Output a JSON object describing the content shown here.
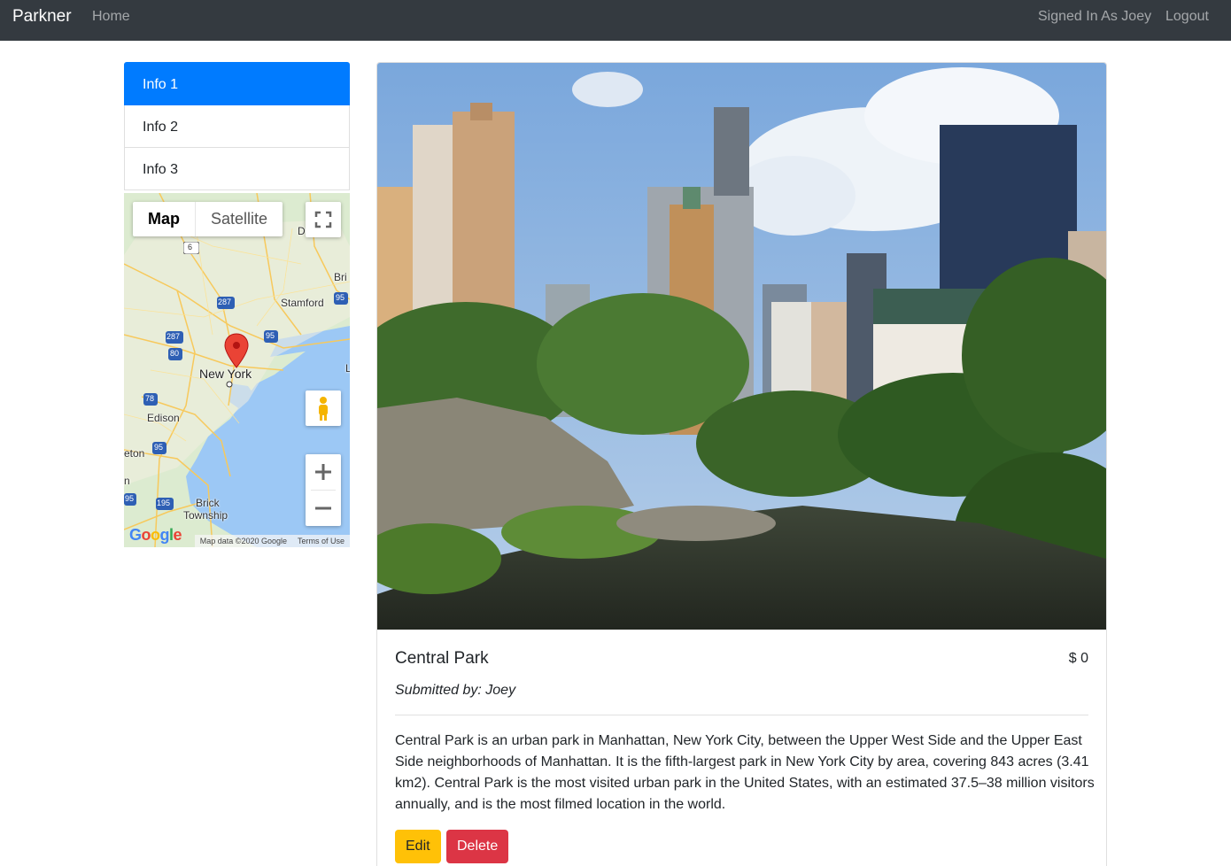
{
  "nav": {
    "brand": "Parkner",
    "home": "Home",
    "signed_in": "Signed In As Joey",
    "logout": "Logout"
  },
  "sidebar": {
    "items": [
      {
        "label": "Info 1",
        "active": true
      },
      {
        "label": "Info 2",
        "active": false
      },
      {
        "label": "Info 3",
        "active": false
      }
    ]
  },
  "map": {
    "type_map": "Map",
    "type_satellite": "Satellite",
    "labels": {
      "new_york": "New York",
      "stamford": "Stamford",
      "edison": "Edison",
      "brick_line1": "Brick",
      "brick_line2": "Township",
      "bri": "Bri",
      "eton": "eton",
      "d": "D",
      "l": "L",
      "n": "n"
    },
    "shields": [
      "6",
      "287",
      "287",
      "80",
      "95",
      "78",
      "95",
      "95",
      "195",
      "95"
    ],
    "google": "Google",
    "attribution": "Map data ©2020 Google",
    "terms": "Terms of Use",
    "icons": [
      "fullscreen-icon",
      "pegman-icon",
      "zoom-in-icon",
      "zoom-out-icon",
      "map-pin-icon"
    ]
  },
  "park": {
    "name": "Central Park",
    "price": "$ 0",
    "submitted_by": "Submitted by: Joey",
    "description": "Central Park is an urban park in Manhattan, New York City, between the Upper West Side and the Upper East Side neighborhoods of Manhattan. It is the fifth-largest park in New York City by area, covering 843 acres (3.41 km2). Central Park is the most visited urban park in the United States, with an estimated 37.5–38 million visitors annually, and is the most filmed location in the world.",
    "edit_label": "Edit",
    "delete_label": "Delete"
  },
  "colors": {
    "navbar": "#343a40",
    "active": "#007bff",
    "edit": "#ffc107",
    "delete": "#dc3545"
  }
}
